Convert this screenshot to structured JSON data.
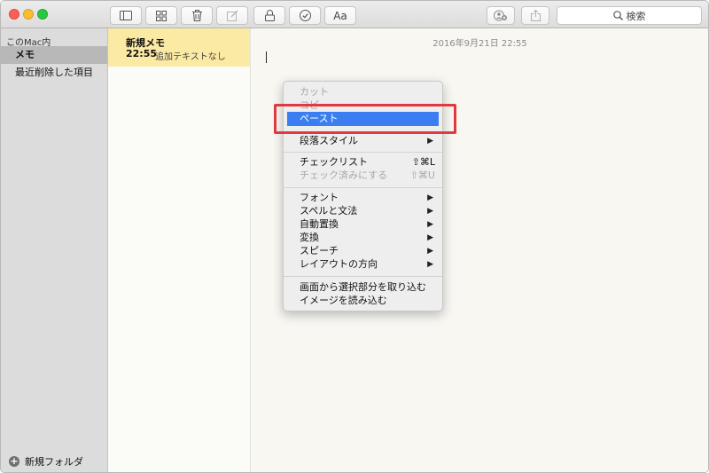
{
  "toolbar": {
    "search_placeholder": "検索",
    "font_button_label": "Aa"
  },
  "sidebar": {
    "heading": "このMac内",
    "items": [
      {
        "label": "メモ",
        "selected": true
      },
      {
        "label": "最近削除した項目",
        "selected": false
      }
    ],
    "new_folder_label": "新規フォルダ"
  },
  "notes": [
    {
      "title": "新規メモ",
      "time": "22:55",
      "preview": "追加テキストなし"
    }
  ],
  "editor": {
    "date": "2016年9月21日 22:55"
  },
  "context_menu": {
    "items": [
      {
        "label": "カット",
        "state": "disabled"
      },
      {
        "label": "コピー",
        "state": "disabled"
      },
      {
        "label": "ペースト",
        "state": "highlighted"
      },
      {
        "label": "段落スタイル",
        "submenu": true
      },
      {
        "label": "チェックリスト",
        "shortcut": "⇧⌘L"
      },
      {
        "label": "チェック済みにする",
        "state": "disabled",
        "shortcut": "⇧⌘U"
      },
      {
        "label": "フォント",
        "submenu": true
      },
      {
        "label": "スペルと文法",
        "submenu": true
      },
      {
        "label": "自動置換",
        "submenu": true
      },
      {
        "label": "変換",
        "submenu": true
      },
      {
        "label": "スピーチ",
        "submenu": true
      },
      {
        "label": "レイアウトの方向",
        "submenu": true
      },
      {
        "label": "画面から選択部分を取り込む"
      },
      {
        "label": "イメージを読み込む"
      }
    ]
  },
  "colors": {
    "highlight": "#3a7ef2",
    "callout": "#e0393f",
    "note_selected": "#fbeaa4"
  }
}
